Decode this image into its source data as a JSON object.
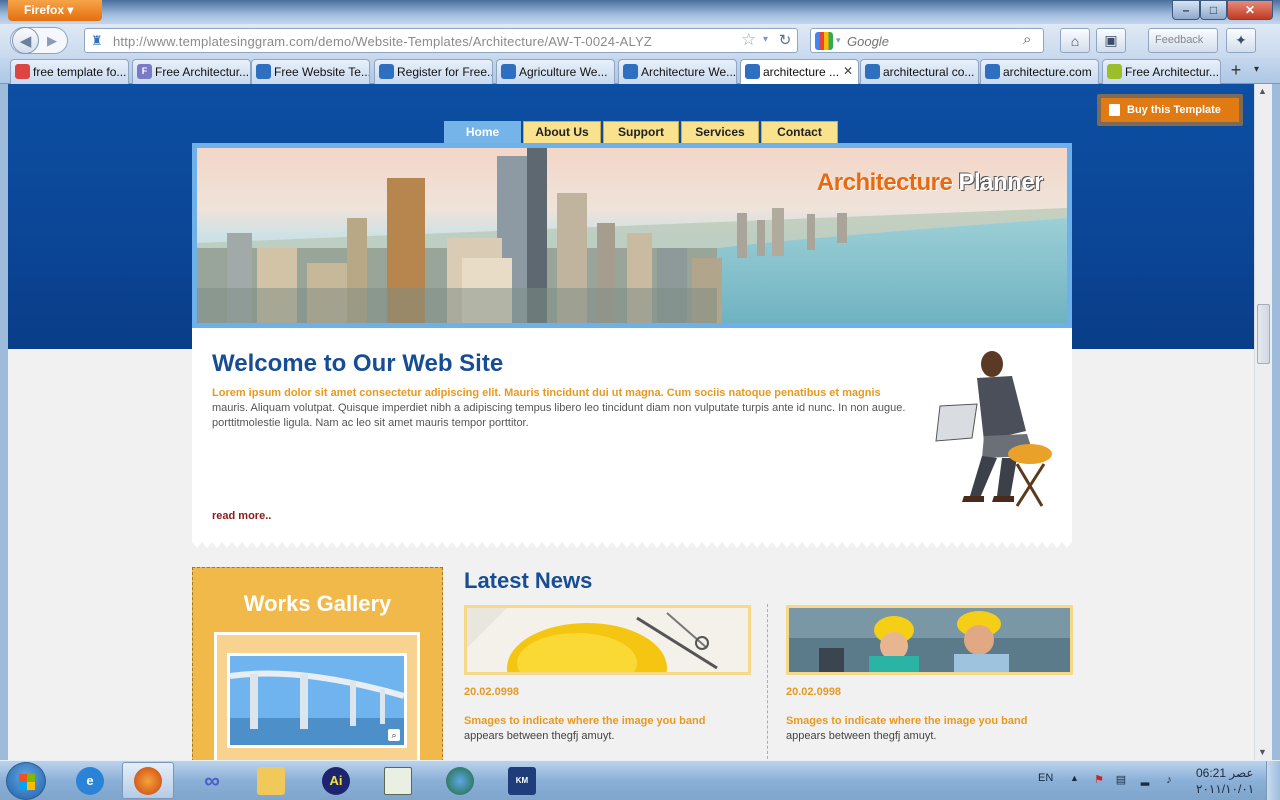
{
  "window": {
    "app_button": "Firefox",
    "min": "–",
    "max": "□",
    "close": "✕"
  },
  "navbar": {
    "url": "http://www.templatesinggram.com/demo/Website-Templates/Architecture/AW-T-0024-ALYZ",
    "search_engine": "Google",
    "search_placeholder": "Google",
    "feedback_label": "Feedback"
  },
  "tabs": [
    {
      "label": "free template fo...",
      "color": "#d44"
    },
    {
      "label": "Free Architectur...",
      "color": "#7a7ac9",
      "badge": "FAA"
    },
    {
      "label": "Free Website Te...",
      "color": "#2f6fbf"
    },
    {
      "label": "Register for Free...",
      "color": "#2f6fbf"
    },
    {
      "label": "Agriculture We...",
      "color": "#2f6fbf"
    },
    {
      "label": "Architecture We...",
      "color": "#2f6fbf"
    },
    {
      "label": "architecture ...",
      "color": "#2f6fbf",
      "active": true
    },
    {
      "label": "architectural co...",
      "color": "#2f6fbf"
    },
    {
      "label": "architecture.com",
      "color": "#2f6fbf"
    },
    {
      "label": "Free Architectur...",
      "color": "#9bbf2a"
    }
  ],
  "page": {
    "buy_button": "Buy this Template",
    "nav": [
      {
        "label": "Home",
        "active": true
      },
      {
        "label": "About Us"
      },
      {
        "label": "Support"
      },
      {
        "label": "Services"
      },
      {
        "label": "Contact"
      }
    ],
    "banner_title_1": "Architecture",
    "banner_title_2": "Planner",
    "welcome_title": "Welcome to Our Web Site",
    "welcome_lead": "Lorem ipsum dolor sit amet consectetur adipiscing elit. Mauris tincidunt dui ut magna. Cum sociis natoque penatibus et magnis",
    "welcome_body": "mauris. Aliquam volutpat. Quisque imperdiet nibh a adipiscing tempus libero leo tincidunt diam non vulputate turpis ante id nunc. In non augue. porttitmolestie ligula. Nam ac leo sit amet mauris tempor porttitor.",
    "read_more": "read more..",
    "gallery_title": "Works Gallery",
    "news_title": "Latest News",
    "news": [
      {
        "date": "20.02.0998",
        "headline": "Smages to indicate where the image you band",
        "text": "appears between thegfj amuyt."
      },
      {
        "date": "20.02.0998",
        "headline": "Smages to indicate where the image you band",
        "text": "appears between thegfj amuyt."
      }
    ]
  },
  "taskbar": {
    "language": "EN",
    "time": "06:21 عصر",
    "date": "٢٠١١/١٠/٠١"
  }
}
